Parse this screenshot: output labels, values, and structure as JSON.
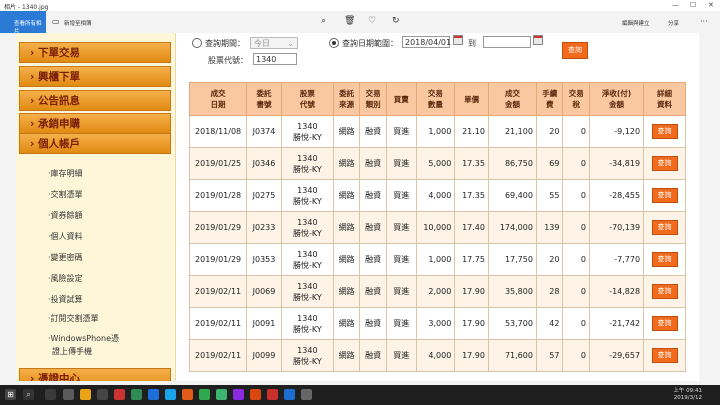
{
  "window": {
    "title": "相片 - 1340.jpg",
    "controls": [
      "—",
      "☐",
      "✕"
    ]
  },
  "toolbar": {
    "see_all_photos": "查看所有相片",
    "add_to_album": "新增至相簿",
    "edit_create": "編輯與建立",
    "share": "分享",
    "more": "···"
  },
  "sidebar": {
    "nav": [
      "下單交易",
      "興櫃下單",
      "公告訊息",
      "承銷申購",
      "個人帳戶"
    ],
    "sub_items": [
      "·庫存明細",
      "·交割憑單",
      "·資券餘額",
      "·個人資料",
      "·變更密碼",
      "·風險設定",
      "·投資試算",
      "·訂閱交割憑單",
      "·WindowsPhone憑",
      "證上傳手機"
    ],
    "bottom_nav": "憑證中心"
  },
  "query": {
    "period_label": "查詢期間：",
    "period_value": "今日",
    "date_range_label": "查詢日期範圍：",
    "date_from": "2018/04/01",
    "to_label": "到",
    "date_to": "",
    "stock_label": "股票代號：",
    "stock_value": "1340",
    "query_button": "查詢"
  },
  "table": {
    "headers": [
      "成交\n日期",
      "委託\n書號",
      "股票\n代號",
      "委託\n來源",
      "交易\n類別",
      "買賣",
      "交易\n數量",
      "單價",
      "成交\n金額",
      "手續\n費",
      "交易\n稅",
      "淨收(付)\n金額",
      "詳細\n資料"
    ],
    "detail_label": "查詢",
    "rows": [
      {
        "date": "2018/11/08",
        "order": "J0374",
        "stock": "1340",
        "name": "勝悅-KY",
        "source": "網路",
        "type": "融資",
        "side": "買進",
        "qty": "1,000",
        "price": "21.10",
        "amount": "21,100",
        "fee": "20",
        "tax": "0",
        "net": "-9,120"
      },
      {
        "date": "2019/01/25",
        "order": "J0346",
        "stock": "1340",
        "name": "勝悅-KY",
        "source": "網路",
        "type": "融資",
        "side": "買進",
        "qty": "5,000",
        "price": "17.35",
        "amount": "86,750",
        "fee": "69",
        "tax": "0",
        "net": "-34,819"
      },
      {
        "date": "2019/01/28",
        "order": "J0275",
        "stock": "1340",
        "name": "勝悅-KY",
        "source": "網路",
        "type": "融資",
        "side": "買進",
        "qty": "4,000",
        "price": "17.35",
        "amount": "69,400",
        "fee": "55",
        "tax": "0",
        "net": "-28,455"
      },
      {
        "date": "2019/01/29",
        "order": "J0233",
        "stock": "1340",
        "name": "勝悅-KY",
        "source": "網路",
        "type": "融資",
        "side": "買進",
        "qty": "10,000",
        "price": "17.40",
        "amount": "174,000",
        "fee": "139",
        "tax": "0",
        "net": "-70,139"
      },
      {
        "date": "2019/01/29",
        "order": "J0353",
        "stock": "1340",
        "name": "勝悅-KY",
        "source": "網路",
        "type": "融資",
        "side": "買進",
        "qty": "1,000",
        "price": "17.75",
        "amount": "17,750",
        "fee": "20",
        "tax": "0",
        "net": "-7,770"
      },
      {
        "date": "2019/02/11",
        "order": "J0069",
        "stock": "1340",
        "name": "勝悅-KY",
        "source": "網路",
        "type": "融資",
        "side": "買進",
        "qty": "2,000",
        "price": "17.90",
        "amount": "35,800",
        "fee": "28",
        "tax": "0",
        "net": "-14,828"
      },
      {
        "date": "2019/02/11",
        "order": "J0091",
        "stock": "1340",
        "name": "勝悅-KY",
        "source": "網路",
        "type": "融資",
        "side": "買進",
        "qty": "3,000",
        "price": "17.90",
        "amount": "53,700",
        "fee": "42",
        "tax": "0",
        "net": "-21,742"
      },
      {
        "date": "2019/02/11",
        "order": "J0099",
        "stock": "1340",
        "name": "勝悅-KY",
        "source": "網路",
        "type": "融資",
        "side": "買進",
        "qty": "4,000",
        "price": "17.90",
        "amount": "71,600",
        "fee": "57",
        "tax": "0",
        "net": "-29,657"
      }
    ]
  },
  "taskbar": {
    "time": "上午 09:41",
    "date": "2019/3/12"
  },
  "colors": {
    "accent_blue": "#2b7bd6",
    "nav_orange": "#f0a030",
    "query_orange": "#f26b1d",
    "header_peach": "#f9c7a0"
  }
}
